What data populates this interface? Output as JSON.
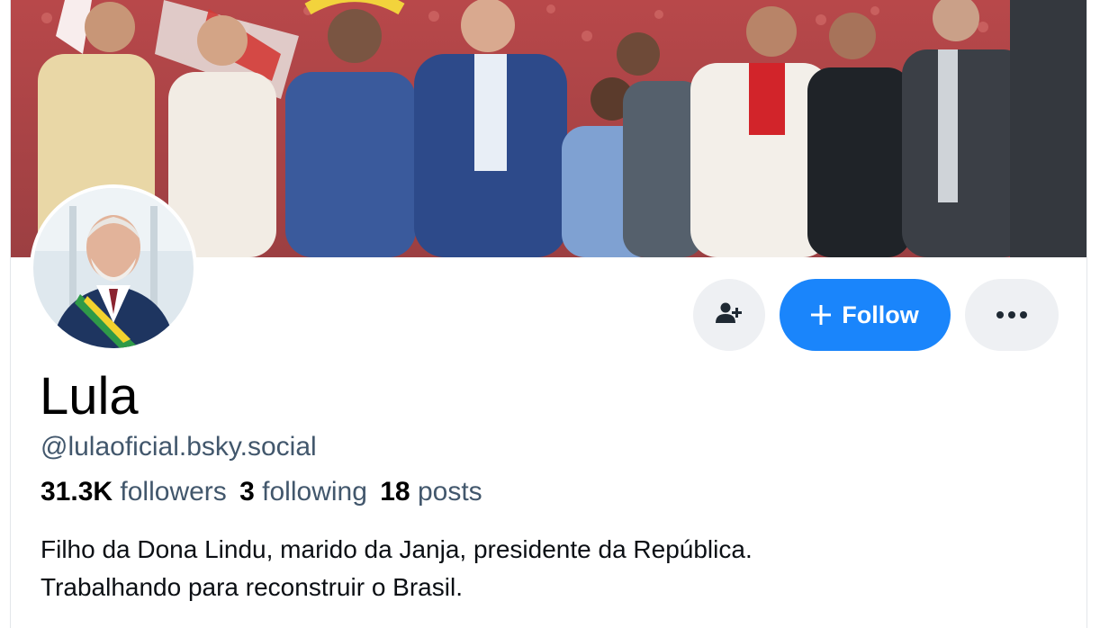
{
  "profile": {
    "display_name": "Lula",
    "handle": "@lulaoficial.bsky.social",
    "stats": {
      "followers_count": "31.3K",
      "followers_label": "followers",
      "following_count": "3",
      "following_label": "following",
      "posts_count": "18",
      "posts_label": "posts"
    },
    "bio_line1": "Filho da Dona Lindu, marido da Janja, presidente da República.",
    "bio_line2": "Trabalhando para reconstruir o Brasil."
  },
  "actions": {
    "follow_label": "Follow",
    "follow_icon": "plus-icon",
    "add_friend_icon": "person-plus-icon",
    "more_icon": "ellipsis-icon"
  },
  "colors": {
    "accent": "#1a85fb",
    "secondary_text": "#42576c",
    "button_bg": "#eef0f3"
  }
}
